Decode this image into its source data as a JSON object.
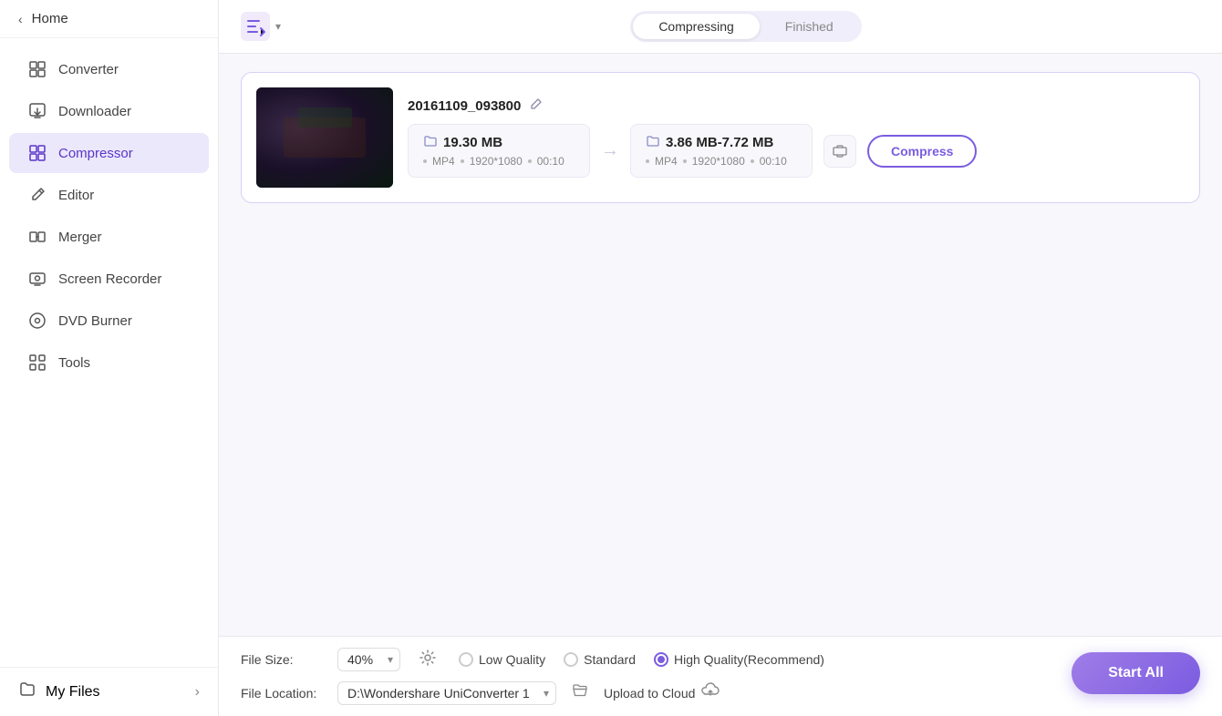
{
  "sidebar": {
    "home_label": "Home",
    "collapse_btn": "‹",
    "nav_items": [
      {
        "id": "converter",
        "label": "Converter",
        "icon": "⊡"
      },
      {
        "id": "downloader",
        "label": "Downloader",
        "icon": "⊞"
      },
      {
        "id": "compressor",
        "label": "Compressor",
        "icon": "▣",
        "active": true
      },
      {
        "id": "editor",
        "label": "Editor",
        "icon": "✂"
      },
      {
        "id": "merger",
        "label": "Merger",
        "icon": "⊟"
      },
      {
        "id": "screen-recorder",
        "label": "Screen Recorder",
        "icon": "⊙"
      },
      {
        "id": "dvd-burner",
        "label": "DVD Burner",
        "icon": "◎"
      },
      {
        "id": "tools",
        "label": "Tools",
        "icon": "⊞"
      }
    ],
    "my_files_label": "My Files",
    "my_files_arrow": "›"
  },
  "topbar": {
    "tabs": [
      {
        "id": "compressing",
        "label": "Compressing",
        "active": true
      },
      {
        "id": "finished",
        "label": "Finished",
        "active": false
      }
    ]
  },
  "file_card": {
    "file_name": "20161109_093800",
    "source": {
      "size": "19.30 MB",
      "format": "MP4",
      "resolution": "1920*1080",
      "duration": "00:10"
    },
    "target": {
      "size": "3.86 MB-7.72 MB",
      "format": "MP4",
      "resolution": "1920*1080",
      "duration": "00:10"
    },
    "compress_btn_label": "Compress"
  },
  "bottom_bar": {
    "file_size_label": "File Size:",
    "file_size_value": "40%",
    "quality_options": [
      {
        "id": "low",
        "label": "Low Quality",
        "selected": false
      },
      {
        "id": "standard",
        "label": "Standard",
        "selected": false
      },
      {
        "id": "high",
        "label": "High Quality(Recommend)",
        "selected": true
      }
    ],
    "file_location_label": "File Location:",
    "file_location_value": "D:\\Wondershare UniConverter 1",
    "upload_cloud_label": "Upload to Cloud",
    "start_all_label": "Start All"
  }
}
